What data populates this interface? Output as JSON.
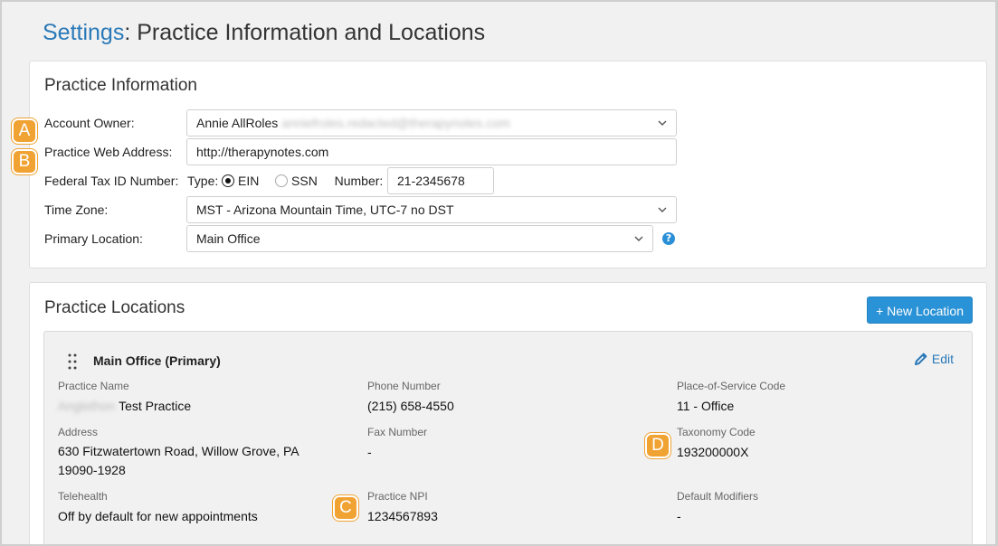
{
  "page": {
    "breadcrumb_link": "Settings",
    "title_rest": ": Practice Information and Locations"
  },
  "practice_info": {
    "heading": "Practice Information",
    "account_owner": {
      "label": "Account Owner:",
      "value": "Annie AllRoles",
      "blurred_text": "anniefroles.redacted@therapynotes.com"
    },
    "web_address": {
      "label": "Practice Web Address:",
      "value": "http://therapynotes.com"
    },
    "tax_id": {
      "label": "Federal Tax ID Number:",
      "type_label": "Type:",
      "option_ein": "EIN",
      "option_ssn": "SSN",
      "selected": "EIN",
      "number_label": "Number:",
      "number_value": "21-2345678"
    },
    "time_zone": {
      "label": "Time Zone:",
      "value": "MST - Arizona Mountain Time, UTC-7 no DST"
    },
    "primary_location": {
      "label": "Primary Location:",
      "value": "Main Office"
    },
    "help_icon_glyph": "?"
  },
  "practice_locations": {
    "heading": "Practice Locations",
    "new_location_button": "+ New Location",
    "location": {
      "name": "Main Office (Primary)",
      "edit_label": "Edit",
      "fields": {
        "practice_name_label": "Practice Name",
        "practice_name_blurred": "Anglethon",
        "practice_name_value": "Test Practice",
        "phone_label": "Phone Number",
        "phone_value": "(215) 658-4550",
        "pos_label": "Place-of-Service Code",
        "pos_value": "11 - Office",
        "address_label": "Address",
        "address_line1": "630 Fitzwatertown Road, Willow Grove, PA",
        "address_line2": "19090-1928",
        "fax_label": "Fax Number",
        "fax_value": "-",
        "taxonomy_label": "Taxonomy Code",
        "taxonomy_value": "193200000X",
        "telehealth_label": "Telehealth",
        "telehealth_value": "Off by default for new appointments",
        "npi_label": "Practice NPI",
        "npi_value": "1234567893",
        "modifiers_label": "Default Modifiers",
        "modifiers_value": "-"
      }
    }
  },
  "callouts": [
    "A",
    "B",
    "C",
    "D"
  ],
  "colors": {
    "accent_blue": "#2a79b8",
    "button_blue": "#2a92d6",
    "callout_orange": "#f0a233"
  }
}
